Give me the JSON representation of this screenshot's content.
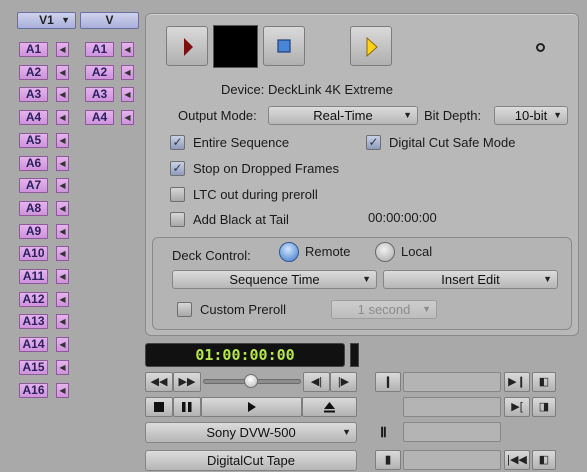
{
  "tracks": {
    "video_labels": [
      "V1",
      "V"
    ],
    "source_audio": [
      "A1",
      "A2",
      "A3",
      "A4",
      "A5",
      "A6",
      "A7",
      "A8",
      "A9",
      "A10",
      "A11",
      "A12",
      "A13",
      "A14",
      "A15",
      "A16"
    ],
    "record_audio": [
      "A1",
      "A2",
      "A3",
      "A4"
    ]
  },
  "panel": {
    "device_text": "Device: DeckLink 4K Extreme",
    "output_mode_label": "Output Mode:",
    "output_mode_value": "Real-Time",
    "bit_depth_label": "Bit Depth:",
    "bit_depth_value": "10-bit",
    "entire_sequence": "Entire Sequence",
    "digital_cut_safe_mode": "Digital Cut Safe Mode",
    "stop_on_dropped": "Stop on Dropped Frames",
    "ltc_out": "LTC out during preroll",
    "add_black": "Add Black at Tail",
    "add_black_time": "00:00:00:00",
    "deck_control_label": "Deck Control:",
    "remote_label": "Remote",
    "local_label": "Local",
    "sequence_time": "Sequence Time",
    "insert_edit": "Insert Edit",
    "custom_preroll": "Custom Preroll",
    "preroll_value": "1 second"
  },
  "transport": {
    "timecode": "01:00:00:00",
    "deck_name": "Sony DVW-500",
    "tape_name": "DigitalCut Tape"
  },
  "colors": {
    "timecode_green": "#b7e64a",
    "track_purple": "#d9a3e6",
    "track_header_blue": "#b6badf"
  }
}
